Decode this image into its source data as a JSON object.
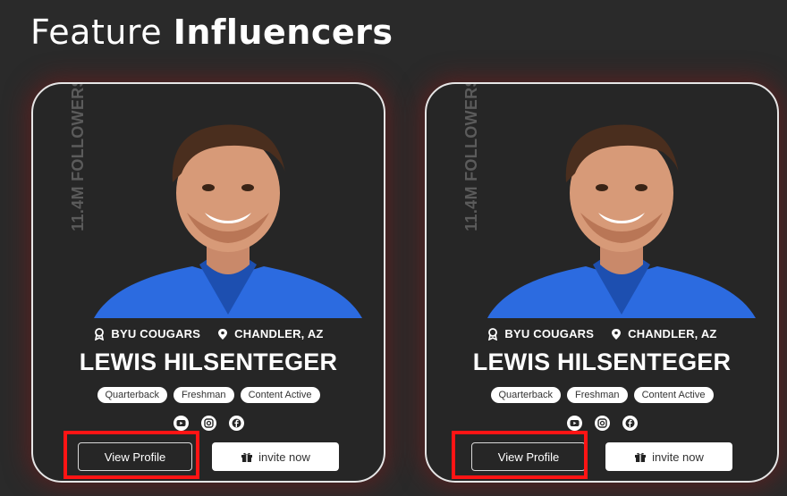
{
  "header": {
    "title_regular": "Feature ",
    "title_bold": "Influencers"
  },
  "cards": [
    {
      "followers": "11.4M FOLLOWERS",
      "team": "BYU COUGARS",
      "location": "CHANDLER, AZ",
      "name": "LEWIS HILSENTEGER",
      "tags": [
        "Quarterback",
        "Freshman",
        "Content Active"
      ],
      "socials": [
        "youtube-icon",
        "instagram-icon",
        "facebook-icon"
      ],
      "view_label": "View Profile",
      "invite_label": "invite now"
    },
    {
      "followers": "11.4M FOLLOWERS",
      "team": "BYU COUGARS",
      "location": "CHANDLER, AZ",
      "name": "LEWIS HILSENTEGER",
      "tags": [
        "Quarterback",
        "Freshman",
        "Content Active"
      ],
      "socials": [
        "youtube-icon",
        "instagram-icon",
        "facebook-icon"
      ],
      "view_label": "View Profile",
      "invite_label": "invite now"
    }
  ],
  "colors": {
    "background": "#2a2a2a",
    "card_glow": "#781919",
    "highlight": "#ff1414",
    "jersey": "#2c6be0"
  }
}
